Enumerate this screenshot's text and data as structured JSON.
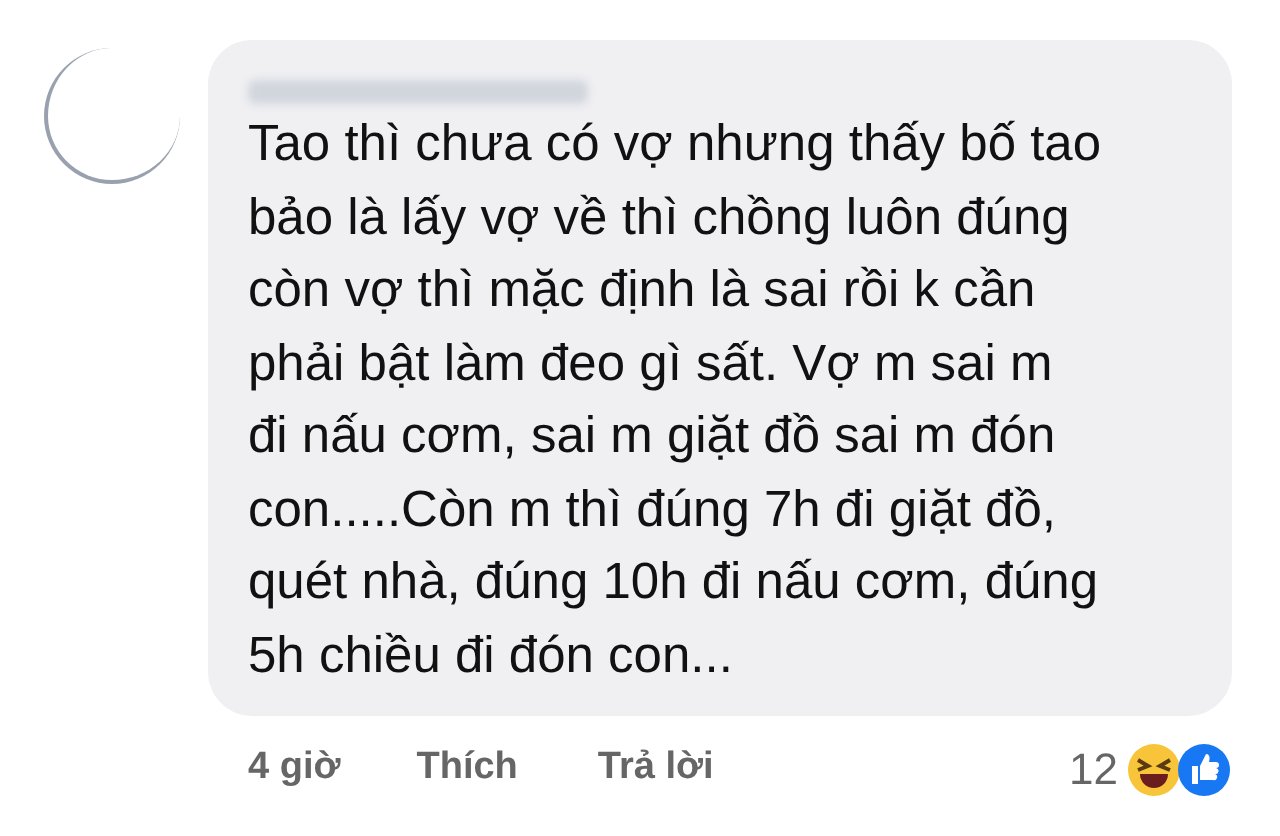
{
  "comment": {
    "text_lines": [
      "Tao thì chưa có vợ nhưng thấy bố tao",
      "bảo là lấy vợ về thì chồng luôn đúng",
      "còn vợ thì mặc định là sai rồi k cần",
      "phải bật làm đeo gì sất. Vợ m sai m",
      "đi nấu cơm, sai m giặt đồ sai m đón",
      "con.....Còn m thì đúng 7h đi giặt đồ,",
      "quét nhà, đúng 10h đi nấu cơm, đúng",
      "5h chiều đi đón con..."
    ],
    "time": "4 giờ",
    "actions": [
      {
        "label": "Thích"
      },
      {
        "label": "Trả lời"
      }
    ],
    "reaction_count": "12"
  }
}
